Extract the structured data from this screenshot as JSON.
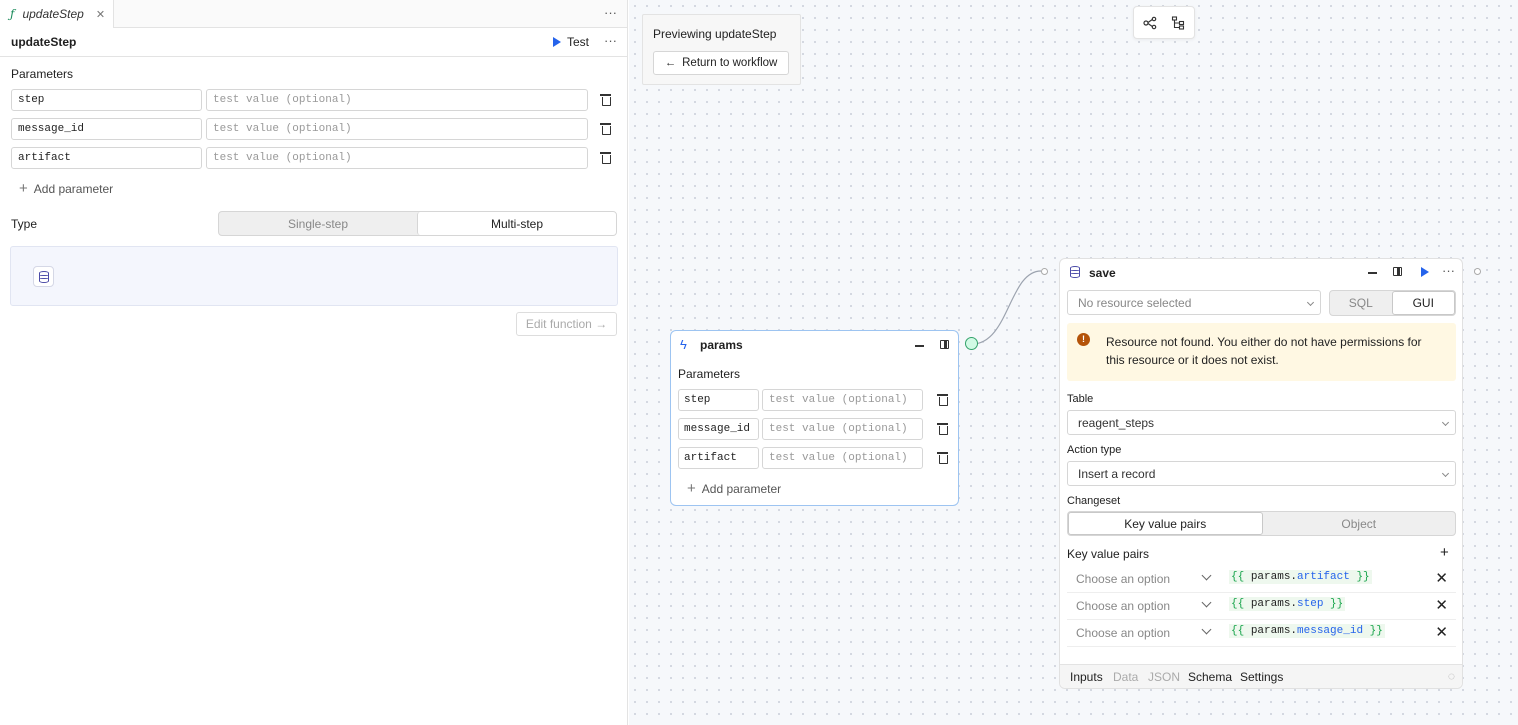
{
  "tab": {
    "icon": "function-icon",
    "name": "updateStep"
  },
  "header": {
    "title": "updateStep",
    "test_label": "Test"
  },
  "parameters": {
    "label": "Parameters",
    "items": [
      {
        "name": "step",
        "placeholder": "test value (optional)"
      },
      {
        "name": "message_id",
        "placeholder": "test value (optional)"
      },
      {
        "name": "artifact",
        "placeholder": "test value (optional)"
      }
    ],
    "add_label": "Add parameter"
  },
  "type": {
    "label": "Type",
    "options": [
      "Single-step",
      "Multi-step"
    ],
    "selected": "Multi-step"
  },
  "edit_function_label": "Edit function →",
  "canvas": {
    "preview_title": "Previewing updateStep",
    "return_label": "Return to workflow",
    "params_node": {
      "title": "params",
      "section": "Parameters",
      "items": [
        {
          "name": "step",
          "placeholder": "test value (optional)"
        },
        {
          "name": "message_id",
          "placeholder": "test value (optional)"
        },
        {
          "name": "artifact",
          "placeholder": "test value (optional)"
        }
      ],
      "add_label": "Add parameter"
    },
    "save_node": {
      "title": "save",
      "resource_placeholder": "No resource selected",
      "mode_options": [
        "SQL",
        "GUI"
      ],
      "mode_selected": "GUI",
      "warning": "Resource not found. You either do not have permissions for this resource or it does not exist.",
      "table_label": "Table",
      "table_value": "reagent_steps",
      "action_label": "Action type",
      "action_value": "Insert a record",
      "changeset_label": "Changeset",
      "changeset_options": [
        "Key value pairs",
        "Object"
      ],
      "changeset_selected": "Key value pairs",
      "kv_label": "Key value pairs",
      "kv_rows": [
        {
          "key_placeholder": "Choose an option",
          "open": "{{",
          "obj": "params.",
          "field": "artifact",
          "close": "}}"
        },
        {
          "key_placeholder": "Choose an option",
          "open": "{{",
          "obj": "params.",
          "field": "step",
          "close": "}}"
        },
        {
          "key_placeholder": "Choose an option",
          "open": "{{",
          "obj": "params.",
          "field": "message_id",
          "close": "}}"
        }
      ],
      "footer_tabs": [
        {
          "label": "Inputs",
          "active": true
        },
        {
          "label": "Data",
          "active": false
        },
        {
          "label": "JSON",
          "active": false
        },
        {
          "label": "Schema",
          "active": true
        },
        {
          "label": "Settings",
          "active": true
        }
      ]
    }
  },
  "colors": {
    "accent": "#2563eb",
    "warning_bg": "#fff8e3",
    "warning_icon": "#b45309",
    "node_border_selected": "#9dc4f1",
    "port_green": "#16a34a"
  }
}
